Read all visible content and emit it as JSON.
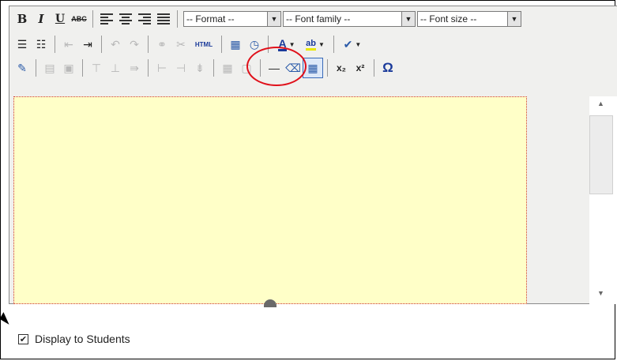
{
  "toolbar": {
    "row1": {
      "bold_label": "B",
      "italic_label": "I",
      "underline_label": "U",
      "strike_label": "ABC",
      "format_select": "-- Format --",
      "font_family_select": "-- Font family --",
      "font_size_select": "-- Font size --"
    },
    "row2": {
      "html_label": "HTML"
    },
    "row3": {
      "subscript_label": "x₂",
      "superscript_label": "x²",
      "omega_label": "Ω"
    }
  },
  "highlight_color": "#e0101a",
  "editor_background": "#ffffc8",
  "display_checkbox": {
    "label": "Display to Students",
    "checked": true,
    "check_glyph": "✔"
  }
}
